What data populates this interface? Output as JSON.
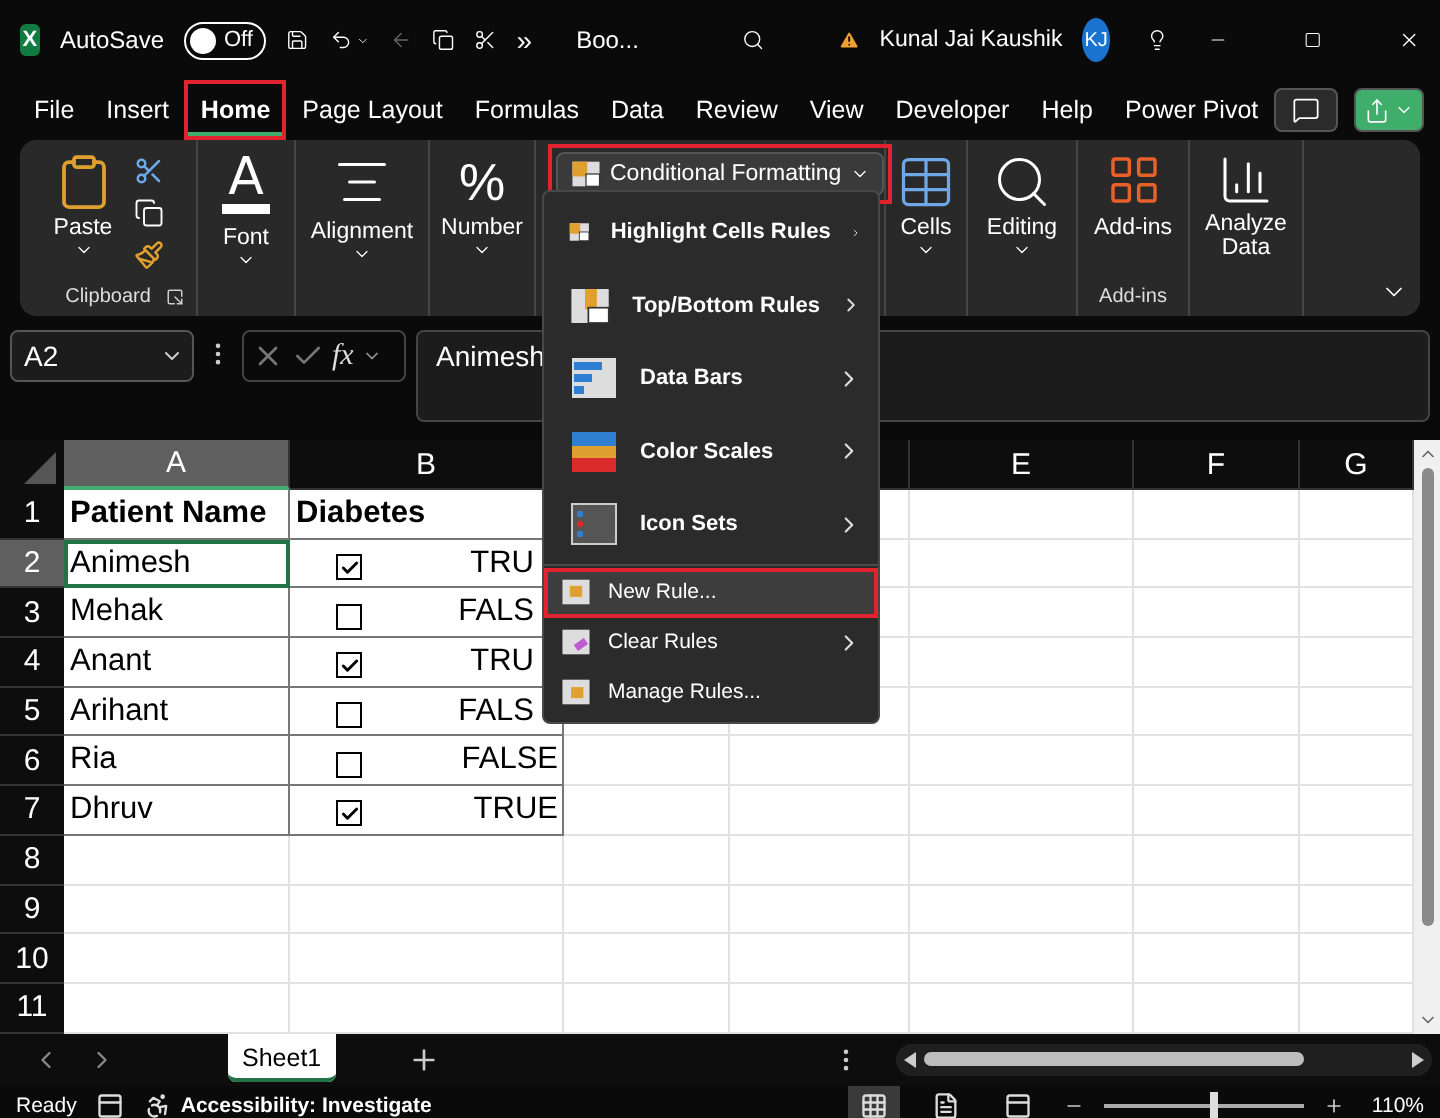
{
  "title_bar": {
    "app_icon": "X",
    "autosave_label": "AutoSave",
    "autosave_on": false,
    "autosave_state": "Off",
    "overflow": "»",
    "document": "Boo...",
    "user": "Kunal Jai Kaushik",
    "avatar": "KJ"
  },
  "menu_tabs": [
    {
      "label": "File",
      "selected": false,
      "highlighted": false
    },
    {
      "label": "Insert",
      "selected": false,
      "highlighted": false
    },
    {
      "label": "Home",
      "selected": true,
      "highlighted": true
    },
    {
      "label": "Page Layout",
      "selected": false,
      "highlighted": false
    },
    {
      "label": "Formulas",
      "selected": false,
      "highlighted": false
    },
    {
      "label": "Data",
      "selected": false,
      "highlighted": false
    },
    {
      "label": "Review",
      "selected": false,
      "highlighted": false
    },
    {
      "label": "View",
      "selected": false,
      "highlighted": false
    },
    {
      "label": "Developer",
      "selected": false,
      "highlighted": false
    },
    {
      "label": "Help",
      "selected": false,
      "highlighted": false
    },
    {
      "label": "Power Pivot",
      "selected": false,
      "highlighted": false
    }
  ],
  "ribbon": {
    "paste": "Paste",
    "clipboard_label": "Clipboard",
    "font_icon": "A",
    "font": "Font",
    "alignment": "Alignment",
    "number_icon": "%",
    "number": "Number",
    "conditional_formatting": {
      "label": "Conditional Formatting",
      "highlighted": true
    },
    "cells": "Cells",
    "editing": "Editing",
    "addins": "Add-ins",
    "addins_label": "Add-ins",
    "analyze": "Analyze Data"
  },
  "formula_bar": {
    "name_box": "A2",
    "function_label": "fx",
    "content": "Animesh"
  },
  "sheet": {
    "columns": [
      {
        "label": "A",
        "selected": true
      },
      {
        "label": "B",
        "selected": false
      },
      {
        "label": "E",
        "selected": false
      },
      {
        "label": "F",
        "selected": false
      },
      {
        "label": "G",
        "selected": false
      }
    ],
    "rows": [
      {
        "number": "1",
        "selected": false,
        "kind": "header",
        "name": "Patient Name",
        "value": "Diabetes"
      },
      {
        "number": "2",
        "selected": true,
        "kind": "data",
        "name": "Animesh",
        "checked": true,
        "value": "TRU"
      },
      {
        "number": "3",
        "selected": false,
        "kind": "data",
        "name": "Mehak",
        "checked": false,
        "value": "FALS"
      },
      {
        "number": "4",
        "selected": false,
        "kind": "data",
        "name": "Anant",
        "checked": true,
        "value": "TRU"
      },
      {
        "number": "5",
        "selected": false,
        "kind": "data",
        "name": "Arihant",
        "checked": false,
        "value": "FALS"
      },
      {
        "number": "6",
        "selected": false,
        "kind": "data",
        "name": "Ria",
        "checked": false,
        "value": "FALSE"
      },
      {
        "number": "7",
        "selected": false,
        "kind": "data",
        "name": "Dhruv",
        "checked": true,
        "value": "TRUE"
      },
      {
        "number": "8",
        "selected": false,
        "kind": "empty"
      },
      {
        "number": "9",
        "selected": false,
        "kind": "empty"
      },
      {
        "number": "10",
        "selected": false,
        "kind": "empty"
      },
      {
        "number": "11",
        "selected": false,
        "kind": "empty"
      }
    ]
  },
  "cf_menu": [
    {
      "label": "Highlight Cells Rules",
      "kind": "large",
      "submenu": true,
      "hovered": false,
      "highlighted": false
    },
    {
      "label": "Top/Bottom Rules",
      "kind": "large",
      "submenu": true,
      "hovered": false,
      "highlighted": false
    },
    {
      "label": "Data Bars",
      "kind": "large",
      "submenu": true,
      "hovered": false,
      "highlighted": false
    },
    {
      "label": "Color Scales",
      "kind": "large",
      "submenu": true,
      "hovered": false,
      "highlighted": false
    },
    {
      "label": "Icon Sets",
      "kind": "large",
      "submenu": true,
      "hovered": false,
      "highlighted": false
    },
    {
      "label": "New Rule...",
      "kind": "small",
      "submenu": false,
      "hovered": true,
      "highlighted": true
    },
    {
      "label": "Clear Rules",
      "kind": "small",
      "submenu": true,
      "hovered": false,
      "highlighted": false
    },
    {
      "label": "Manage Rules...",
      "kind": "small",
      "submenu": false,
      "hovered": false,
      "highlighted": false
    }
  ],
  "sheet_tabs": [
    {
      "label": "Sheet1",
      "selected": true
    }
  ],
  "status_bar": {
    "mode": "Ready",
    "accessibility": "Accessibility: Investigate",
    "views": [
      {
        "kind": "normal",
        "selected": true
      },
      {
        "kind": "page_layout",
        "selected": false
      },
      {
        "kind": "page_break",
        "selected": false
      }
    ],
    "zoom_slider": {
      "level": 0.55
    },
    "zoom": "110%"
  }
}
